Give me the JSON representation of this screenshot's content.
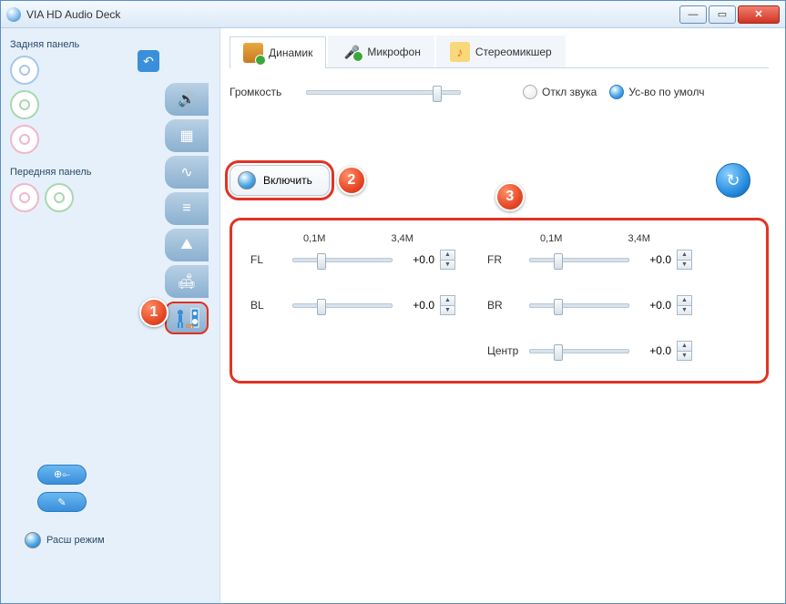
{
  "window": {
    "title": "VIA HD Audio Deck"
  },
  "sidebar": {
    "rear_label": "Задняя панель",
    "front_label": "Передняя панель",
    "mode_label": "Расш режим"
  },
  "tabs": {
    "speaker": "Динамик",
    "mic": "Микрофон",
    "mixer": "Стереомикшер"
  },
  "volume": {
    "label": "Громкость",
    "mute_label": "Откл звука",
    "default_label": "Ус-во по умолч",
    "position_pct": 82
  },
  "enable_label": "Включить",
  "scale": {
    "min": "0,1М",
    "max": "3,4М"
  },
  "channels": {
    "FL": {
      "label": "FL",
      "value": "+0.0"
    },
    "FR": {
      "label": "FR",
      "value": "+0.0"
    },
    "BL": {
      "label": "BL",
      "value": "+0.0"
    },
    "BR": {
      "label": "BR",
      "value": "+0.0"
    },
    "Center": {
      "label": "Центр",
      "value": "+0.0"
    }
  },
  "markers": {
    "m1": "1",
    "m2": "2",
    "m3": "3"
  }
}
